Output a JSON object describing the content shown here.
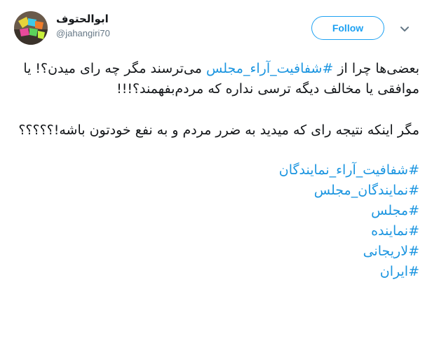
{
  "user": {
    "name": "ابوالحتوف",
    "handle": "@jahangiri70"
  },
  "follow_button": {
    "label": "Follow"
  },
  "colors": {
    "accent": "#1da1f2",
    "hashtag": "#1b95e0",
    "text": "#14171a",
    "muted": "#657786"
  },
  "icons": {
    "more": "chevron-down-icon"
  },
  "tweet": {
    "para1": {
      "before": "بعضی‌ها چرا از ",
      "hashtag": "#شفافیت_آراء_مجلس",
      "after": " می‌ترسند مگر چه رای میدن؟! یا موافقی یا مخالف دیگه ترسی نداره که مردم‌بفهمند؟!!!"
    },
    "para2": "مگر اینکه نتیجه رای که میدید به ضرر مردم و به نفع خودتون باشه!؟؟؟؟؟",
    "hashtags": [
      "#شفافیت_آراء_نمایندگان",
      "#نمایندگان_مجلس",
      "#مجلس",
      "#نماینده",
      "#لاریجانی",
      "#ایران"
    ]
  }
}
